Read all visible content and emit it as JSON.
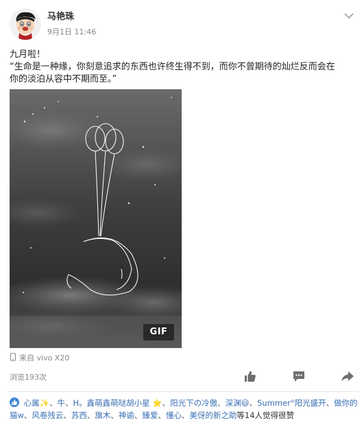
{
  "post": {
    "author_name": "马艳珠",
    "time": "9月1日 11:46",
    "text_line1": "九月啦！",
    "text_line2": "“生命是一种缘，你刻意追求的东西也许终生得不到，而你不曾期待的灿烂反而会在",
    "text_line3": "你的淡泊从容中不期而至。”",
    "image_badge": "GIF",
    "device": "来自 vivo X20",
    "views": "浏览193次"
  },
  "icons": {
    "menu": "chevron-down-icon",
    "device": "phone-icon",
    "like": "thumbs-up-icon",
    "comment": "comment-icon",
    "share": "share-icon",
    "likes_badge": "thumbs-up-icon"
  },
  "likes": {
    "names": [
      "心属✨",
      "牛",
      "H。鑫萌鑫萌哒胡小星 ⭐",
      "阳光下の冷傲",
      "深渊😃",
      "Summer°阳光盛开",
      "做你的猫w",
      "风卷残云",
      "苏西",
      "旗木",
      "神谕",
      "臻爱",
      "懂心",
      "美伢的新之助"
    ],
    "summary": "等14人觉得很赞"
  },
  "colors": {
    "link": "#3a6fb4",
    "like_badge": "#3d86d9",
    "meta": "#888888"
  }
}
